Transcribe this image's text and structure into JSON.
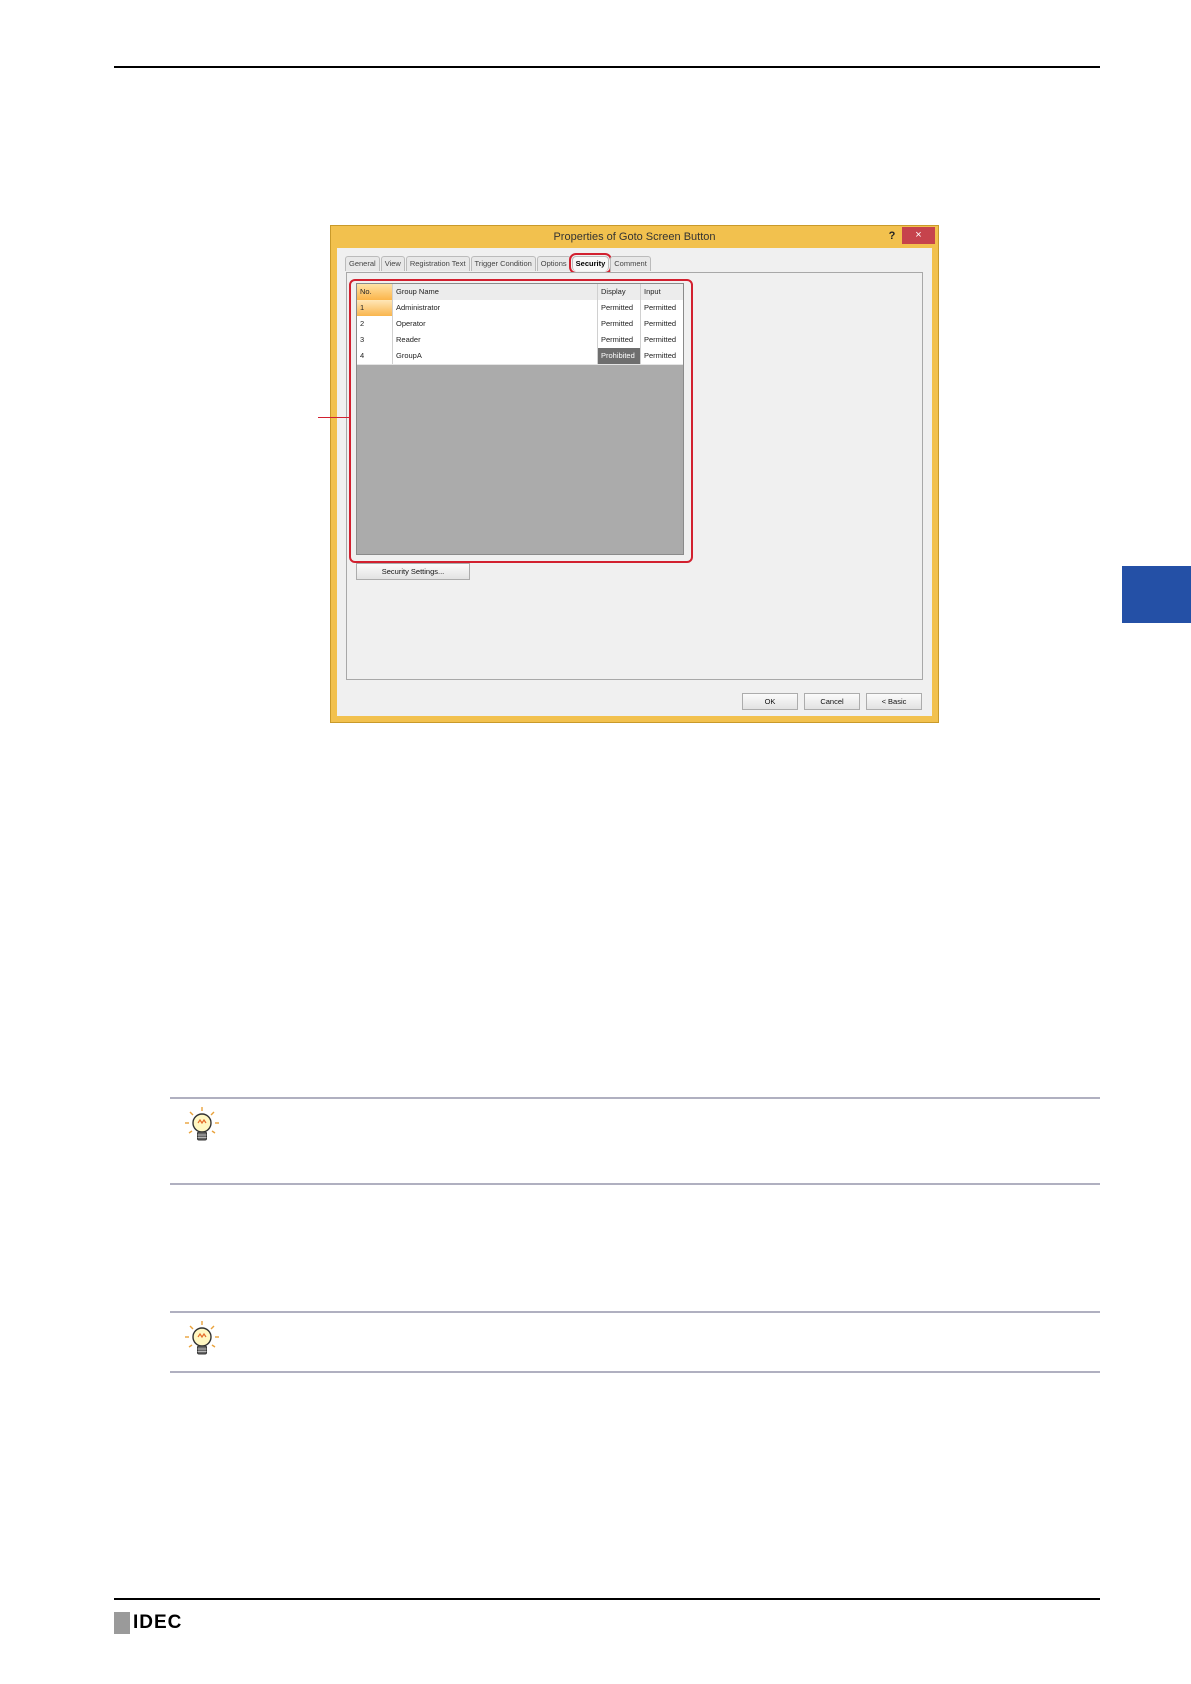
{
  "dialog": {
    "title": "Properties of Goto Screen Button",
    "help_label": "?",
    "close_label": "×",
    "tabs": [
      "General",
      "View",
      "Registration Text",
      "Trigger Condition",
      "Options",
      "Security",
      "Comment"
    ],
    "active_tab": "Security",
    "grid": {
      "headers": [
        "No.",
        "Group Name",
        "Display",
        "Input"
      ],
      "rows": [
        [
          "1",
          "Administrator",
          "Permitted",
          "Permitted"
        ],
        [
          "2",
          "Operator",
          "Permitted",
          "Permitted"
        ],
        [
          "3",
          "Reader",
          "Permitted",
          "Permitted"
        ],
        [
          "4",
          "GroupA",
          "Prohibited",
          "Permitted"
        ]
      ]
    },
    "security_settings_label": "Security Settings...",
    "ok_label": "OK",
    "cancel_label": "Cancel",
    "basic_label": "< Basic"
  },
  "footer": {
    "logo_text": "IDEC"
  },
  "colors": {
    "dialog_frame": "#f2c14e",
    "highlight": "#d2202f",
    "chapter_tab": "#2450a6"
  }
}
